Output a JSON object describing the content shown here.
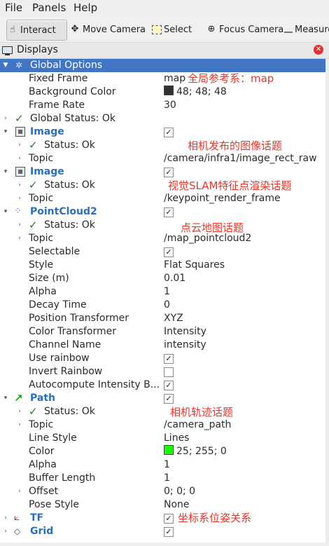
{
  "menu": {
    "file": "File",
    "panels": "Panels",
    "help": "Help"
  },
  "toolbar": {
    "interact": "Interact",
    "move_camera": "Move Camera",
    "select": "Select",
    "focus_camera": "Focus Camera",
    "measure": "Measure"
  },
  "panel": {
    "title": "Displays"
  },
  "tree": {
    "global_options": "Global Options",
    "fixed_frame_label": "Fixed Frame",
    "fixed_frame_value": "map",
    "background_color_label": "Background Color",
    "background_color_value": "48; 48; 48",
    "background_color_hex": "#303030",
    "frame_rate_label": "Frame Rate",
    "frame_rate_value": "30",
    "global_status": "Global Status: Ok",
    "image1_name": "Image",
    "image1_status": "Status: Ok",
    "image1_topic_label": "Topic",
    "image1_topic_value": "/camera/infra1/image_rect_raw",
    "image2_name": "Image",
    "image2_status": "Status: Ok",
    "image2_topic_label": "Topic",
    "image2_topic_value": "/keypoint_render_frame",
    "pc_name": "PointCloud2",
    "pc_status": "Status: Ok",
    "pc_topic_label": "Topic",
    "pc_topic_value": "/map_pointcloud2",
    "selectable_label": "Selectable",
    "style_label": "Style",
    "style_value": "Flat Squares",
    "size_label": "Size (m)",
    "size_value": "0.01",
    "alpha_label": "Alpha",
    "alpha_value": "1",
    "decay_label": "Decay Time",
    "decay_value": "0",
    "pos_tf_label": "Position Transformer",
    "pos_tf_value": "XYZ",
    "color_tf_label": "Color Transformer",
    "color_tf_value": "Intensity",
    "channel_label": "Channel Name",
    "channel_value": "intensity",
    "use_rainbow_label": "Use rainbow",
    "invert_rainbow_label": "Invert Rainbow",
    "autocompute_label": "Autocompute Intensity B...",
    "path_name": "Path",
    "path_status": "Status: Ok",
    "path_topic_label": "Topic",
    "path_topic_value": "/camera_path",
    "line_style_label": "Line Style",
    "line_style_value": "Lines",
    "path_color_label": "Color",
    "path_color_value": "25; 255; 0",
    "path_color_hex": "#19ff00",
    "path_alpha_label": "Alpha",
    "path_alpha_value": "1",
    "buffer_label": "Buffer Length",
    "buffer_value": "1",
    "offset_label": "Offset",
    "offset_value": "0; 0; 0",
    "pose_style_label": "Pose Style",
    "pose_style_value": "None",
    "tf_name": "TF",
    "grid_name": "Grid"
  },
  "annotations": {
    "fixed_frame": "全局参考系：map",
    "image1": "相机发布的图像话题",
    "image2": "视觉SLAM特征点渲染话题",
    "pointcloud": "点云地图话题",
    "path": "相机轨迹话题",
    "tf": "坐标系位姿关系"
  },
  "colors": {
    "selected": "#3f75c2",
    "display_name": "#2b6fb8",
    "annotation": "#e2362a"
  }
}
